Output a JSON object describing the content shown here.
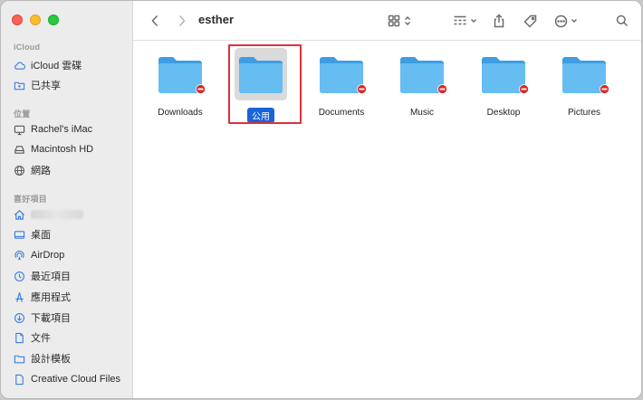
{
  "window": {
    "title": "esther"
  },
  "sidebar": {
    "sections": [
      {
        "title": "iCloud",
        "items": [
          {
            "label": "iCloud 雲碟",
            "icon": "cloud-icon"
          },
          {
            "label": "已共享",
            "icon": "shared-folder-icon"
          }
        ]
      },
      {
        "title": "位置",
        "items": [
          {
            "label": "Rachel's iMac",
            "icon": "imac-icon"
          },
          {
            "label": "Macintosh HD",
            "icon": "disk-icon"
          },
          {
            "label": "網路",
            "icon": "network-globe-icon"
          }
        ]
      },
      {
        "title": "喜好項目",
        "items": [
          {
            "label": "",
            "icon": "home-icon"
          },
          {
            "label": "桌面",
            "icon": "desktop-icon"
          },
          {
            "label": "AirDrop",
            "icon": "airdrop-icon"
          },
          {
            "label": "最近項目",
            "icon": "clock-icon"
          },
          {
            "label": "應用程式",
            "icon": "applications-icon"
          },
          {
            "label": "下載項目",
            "icon": "download-icon"
          },
          {
            "label": "文件",
            "icon": "document-icon"
          },
          {
            "label": "設計模板",
            "icon": "folder-icon"
          },
          {
            "label": "Creative Cloud Files",
            "icon": "file-icon"
          }
        ]
      }
    ]
  },
  "folders": [
    {
      "label": "Downloads",
      "selected": false
    },
    {
      "label": "公用",
      "selected": true
    },
    {
      "label": "Documents",
      "selected": false
    },
    {
      "label": "Music",
      "selected": false
    },
    {
      "label": "Desktop",
      "selected": false
    },
    {
      "label": "Pictures",
      "selected": false
    }
  ],
  "colors": {
    "accent": "#1a63d8",
    "folder": "#5ab2ec",
    "highlight": "#e0303a",
    "badge": "#d92a2a"
  }
}
